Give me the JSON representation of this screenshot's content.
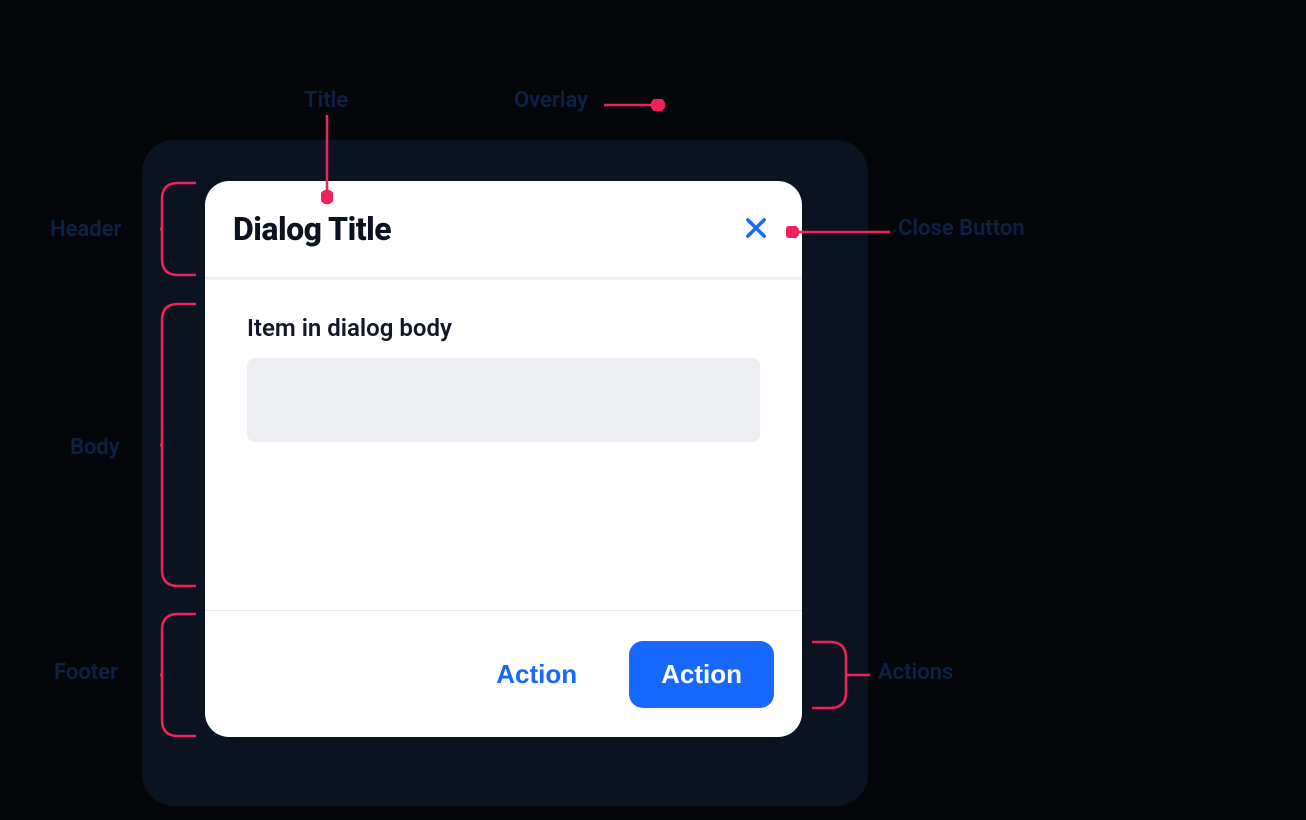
{
  "annotations": {
    "title": "Title",
    "overlay": "Overlay",
    "header": "Header",
    "close_button": "Close Button",
    "body": "Body",
    "footer": "Footer",
    "actions": "Actions"
  },
  "dialog": {
    "title": "Dialog Title",
    "body_item_label": "Item in dialog body",
    "actions": {
      "secondary_label": "Action",
      "primary_label": "Action"
    }
  }
}
